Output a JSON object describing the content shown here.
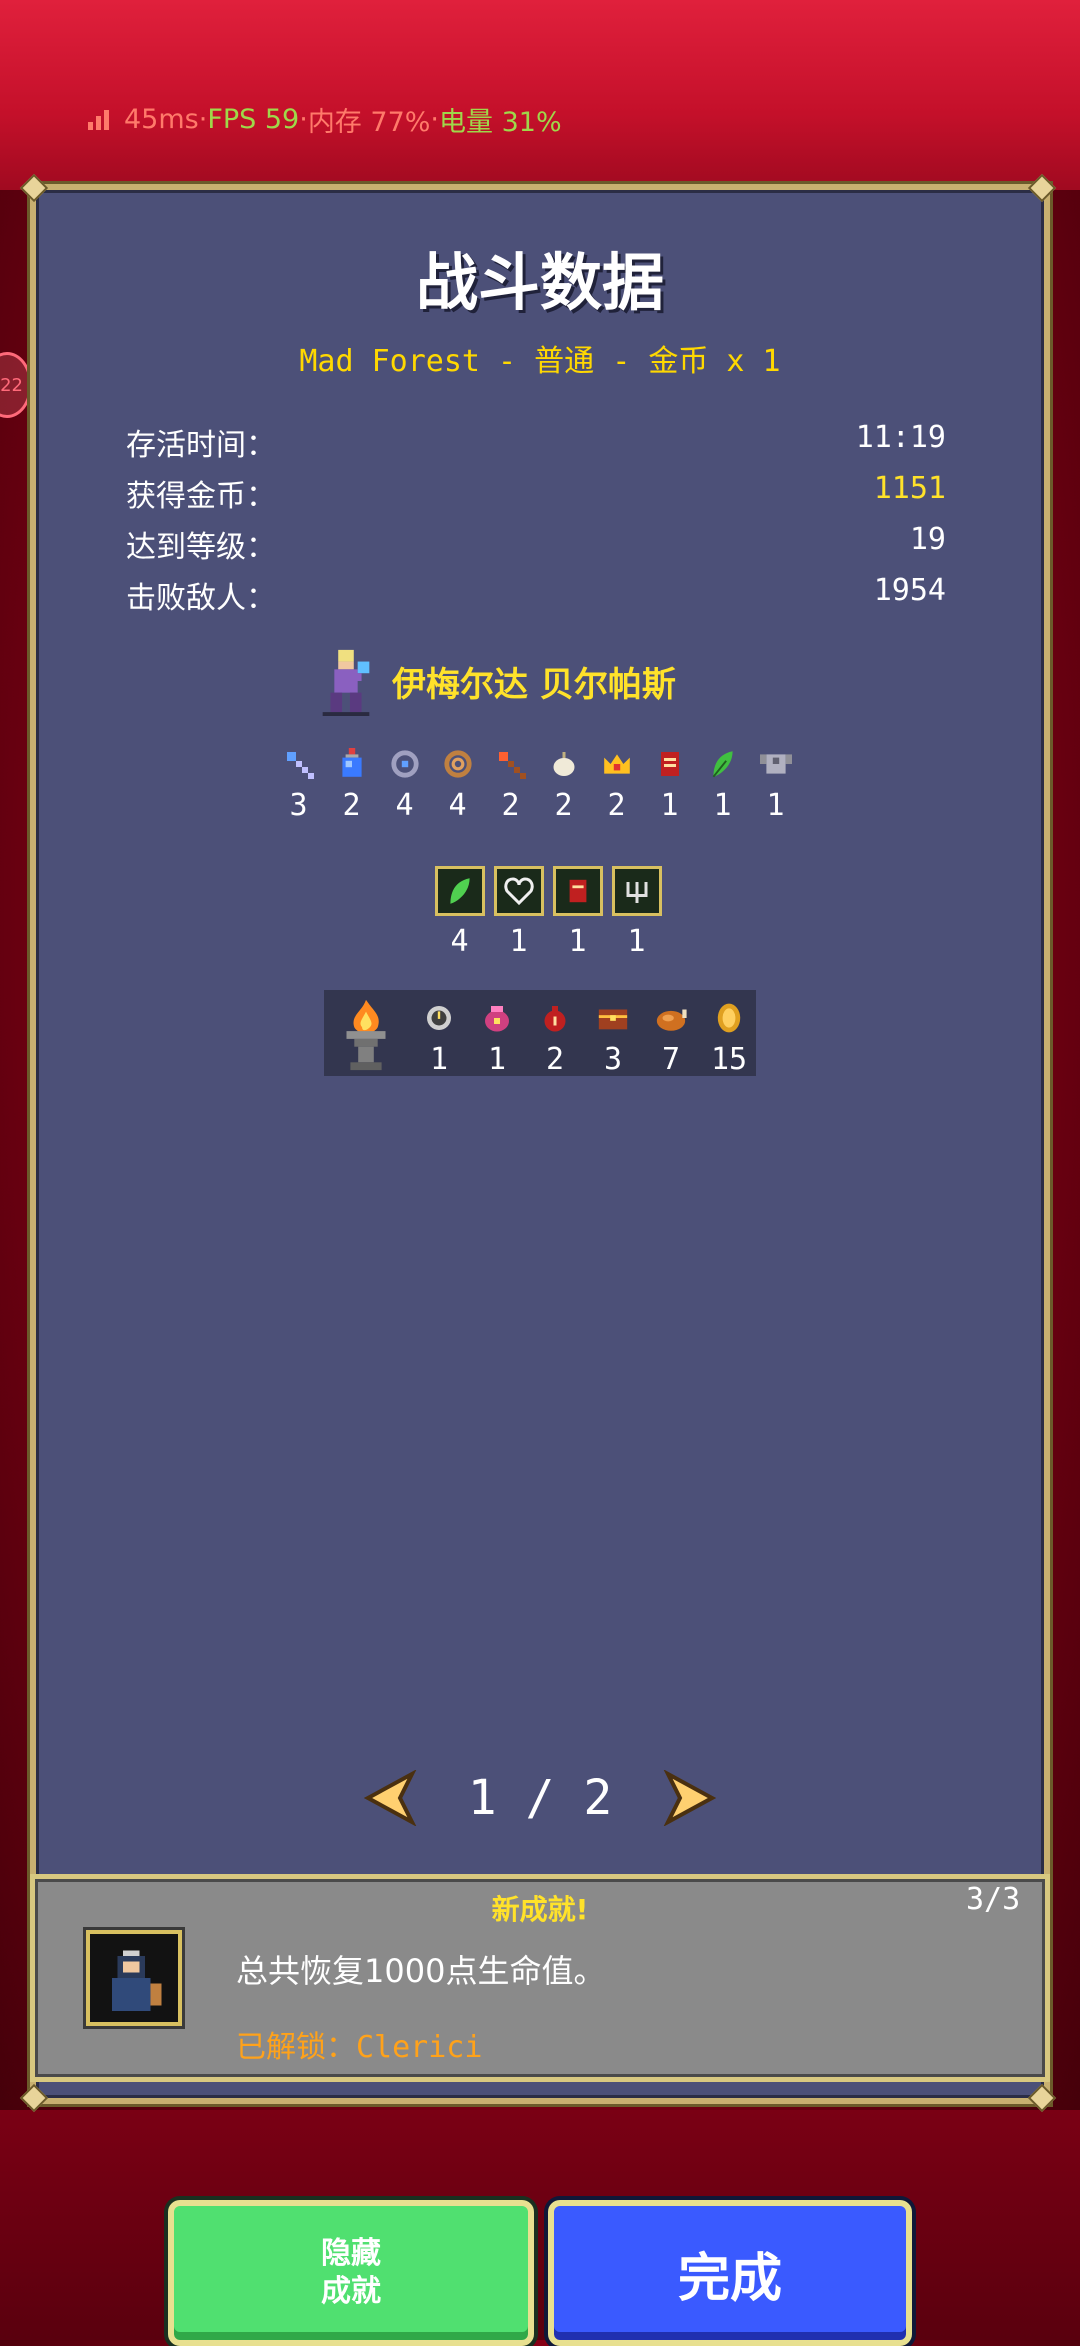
{
  "status_bar": {
    "latency": "45ms",
    "fps": "FPS 59",
    "memory": "内存 77%",
    "battery": "电量 31%",
    "separator": " · "
  },
  "side_bubble": {
    "text": "22"
  },
  "panel": {
    "title": "战斗数据",
    "subtitle": "Mad Forest - 普通 - 金币 x 1",
    "stats": [
      {
        "label": "存活时间：",
        "value": "11:19"
      },
      {
        "label": "获得金币：",
        "value": "1151"
      },
      {
        "label": "达到等级：",
        "value": "19"
      },
      {
        "label": "击败敌人：",
        "value": "1954"
      }
    ],
    "character": {
      "name": "伊梅尔达 贝尔帕斯",
      "icon": "character-sprite-icon"
    },
    "weapons": [
      {
        "icon": "magic-wand-icon",
        "count": "3"
      },
      {
        "icon": "potion-flask-icon",
        "count": "2"
      },
      {
        "icon": "whip-ring-icon",
        "count": "4"
      },
      {
        "icon": "lasso-icon",
        "count": "4"
      },
      {
        "icon": "fire-wand-icon",
        "count": "2"
      },
      {
        "icon": "garlic-icon",
        "count": "2"
      },
      {
        "icon": "crown-icon",
        "count": "2"
      },
      {
        "icon": "tome-icon",
        "count": "1"
      },
      {
        "icon": "feather-icon",
        "count": "1"
      },
      {
        "icon": "armor-icon",
        "count": "1"
      }
    ],
    "passives": [
      {
        "icon": "feather-box-icon",
        "count": "4"
      },
      {
        "icon": "heart-box-icon",
        "count": "1"
      },
      {
        "icon": "tome-box-icon",
        "count": "1"
      },
      {
        "icon": "candelabra-box-icon",
        "count": "1"
      }
    ],
    "pickups": [
      {
        "icon": "orologion-icon",
        "count": "1"
      },
      {
        "icon": "coin-pouch-icon",
        "count": "1"
      },
      {
        "icon": "money-bag-icon",
        "count": "2"
      },
      {
        "icon": "treasure-chest-icon",
        "count": "3"
      },
      {
        "icon": "roast-chicken-icon",
        "count": "7"
      },
      {
        "icon": "gold-coin-icon",
        "count": "15"
      }
    ],
    "pager": {
      "current": "1",
      "separator": "/",
      "total": "2"
    }
  },
  "achievement": {
    "header": "新成就!",
    "counter": "3/3",
    "description": "总共恢复1000点生命值。",
    "unlock_prefix": "已解锁：",
    "unlock_name": "Clerici"
  },
  "buttons": {
    "hide_line1": "隐藏",
    "hide_line2": "成就",
    "done": "完成"
  },
  "colors": {
    "accent_gold": "#ffe22a",
    "panel_bg": "#4c5078",
    "hide_btn": "#50e070",
    "done_btn": "#3a5aff",
    "unlock_orange": "#ffa21a"
  }
}
